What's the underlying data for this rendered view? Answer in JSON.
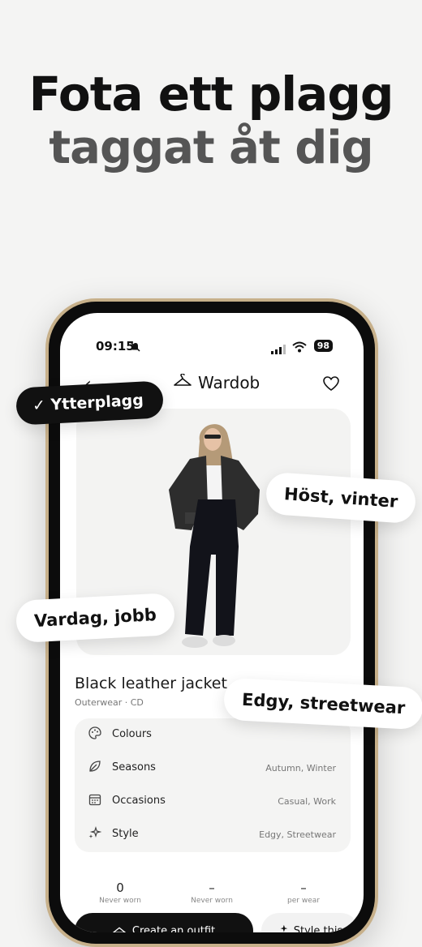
{
  "headline": {
    "line1": "Fota ett plagg",
    "line2": "taggat åt dig"
  },
  "status_bar": {
    "time": "09:15",
    "battery": "98"
  },
  "nav": {
    "back_label": "‹",
    "brand": "Wardob"
  },
  "item": {
    "title": "Black leather jacket",
    "subtitle": "Outerwear · CD"
  },
  "details": [
    {
      "icon": "palette-icon",
      "label": "Colours",
      "value": ""
    },
    {
      "icon": "leaf-icon",
      "label": "Seasons",
      "value": "Autumn, Winter"
    },
    {
      "icon": "calendar-icon",
      "label": "Occasions",
      "value": "Casual, Work"
    },
    {
      "icon": "sparkles-icon",
      "label": "Style",
      "value": "Edgy, Streetwear"
    }
  ],
  "stats": [
    {
      "value": "0",
      "label": "Never worn"
    },
    {
      "value": "–",
      "label": "Never worn"
    },
    {
      "value": "–",
      "label": "per wear"
    }
  ],
  "buttons": {
    "primary": "Create an outfit",
    "secondary": "Style this"
  },
  "tags": {
    "category": "Ytterplagg",
    "season": "Höst, vinter",
    "occasion": "Vardag, jobb",
    "style": "Edgy, streetwear"
  },
  "colors": {
    "accent": "#111111",
    "phone_frame": "#c7b08a",
    "background": "#f4f4f3"
  }
}
